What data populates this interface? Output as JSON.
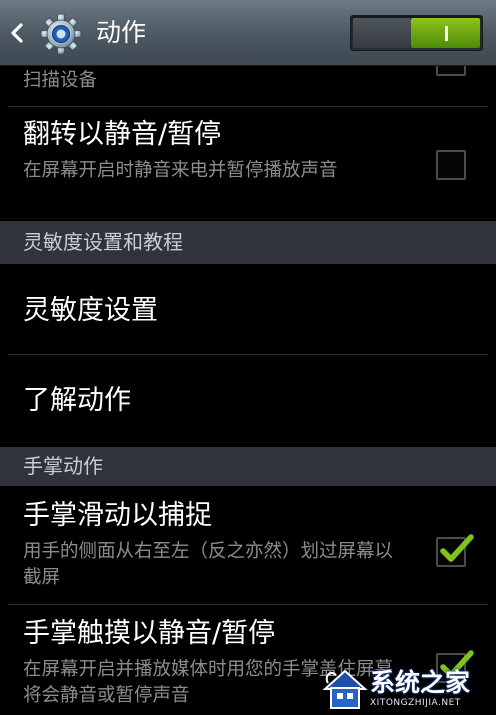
{
  "header": {
    "title": "动作",
    "toggle_on": true,
    "back_icon": "chevron-left-icon",
    "settings_icon": "gear-icon"
  },
  "items": {
    "scan_devices": {
      "summary": "扫描设备",
      "checked": false
    },
    "flip_mute": {
      "title": "翻转以静音/暂停",
      "summary": "在屏幕开启时静音来电并暂停播放声音",
      "checked": false
    },
    "sensitivity_settings": {
      "title": "灵敏度设置"
    },
    "learn_motions": {
      "title": "了解动作"
    },
    "palm_swipe": {
      "title": "手掌滑动以捕捉",
      "summary": "用手的侧面从右至左（反之亦然）划过屏幕以截屏",
      "checked": true
    },
    "palm_touch": {
      "title": "手掌触摸以静音/暂停",
      "summary": "在屏幕开启并播放媒体时用您的手掌盖住屏幕将会静音或暂停声音",
      "checked": true
    }
  },
  "sections": {
    "sensitivity": "灵敏度设置和教程",
    "palm_motion": "手掌动作"
  },
  "watermark": {
    "text": "系统之家",
    "url": "XITONGZHIJIA.NET"
  },
  "colors": {
    "accent_green": "#7fc41b",
    "action_bar": "#4b5761",
    "section_header": "#30343a",
    "secondary_text": "#8c8c8c"
  }
}
